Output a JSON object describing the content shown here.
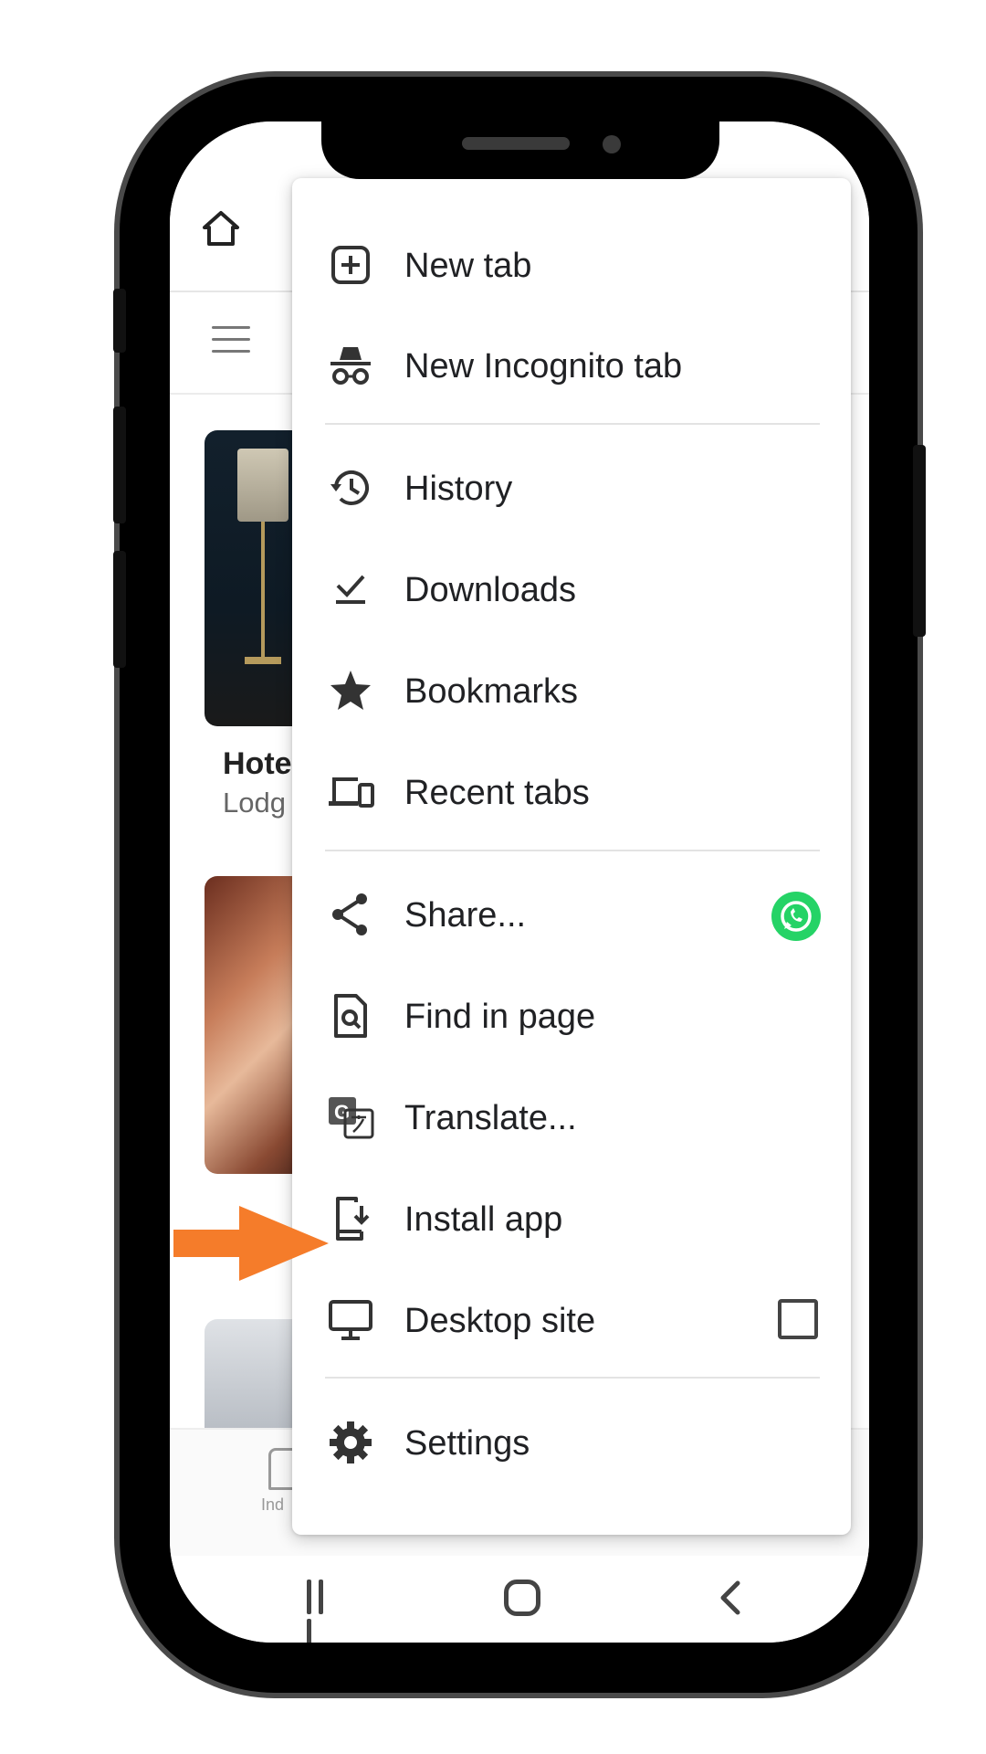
{
  "background_page": {
    "card1": {
      "title": "Hote",
      "subtitle": "Lodg"
    },
    "bottom_tab": {
      "label": "Ind"
    }
  },
  "menu": {
    "items": [
      {
        "label": "New tab",
        "icon": "add-box-icon"
      },
      {
        "label": "New Incognito tab",
        "icon": "incognito-icon"
      },
      {
        "label": "History",
        "icon": "history-icon"
      },
      {
        "label": "Downloads",
        "icon": "download-done-icon"
      },
      {
        "label": "Bookmarks",
        "icon": "star-icon"
      },
      {
        "label": "Recent tabs",
        "icon": "devices-icon"
      },
      {
        "label": "Share...",
        "icon": "share-icon",
        "badge": "whatsapp-icon"
      },
      {
        "label": "Find in page",
        "icon": "find-in-page-icon"
      },
      {
        "label": "Translate...",
        "icon": "translate-icon"
      },
      {
        "label": "Install app",
        "icon": "install-app-icon"
      },
      {
        "label": "Desktop site",
        "icon": "desktop-icon",
        "checkbox": false
      },
      {
        "label": "Settings",
        "icon": "gear-icon"
      }
    ]
  },
  "colors": {
    "highlight_arrow": "#f57c2a",
    "whatsapp": "#25d366",
    "menu_text": "#202124"
  }
}
